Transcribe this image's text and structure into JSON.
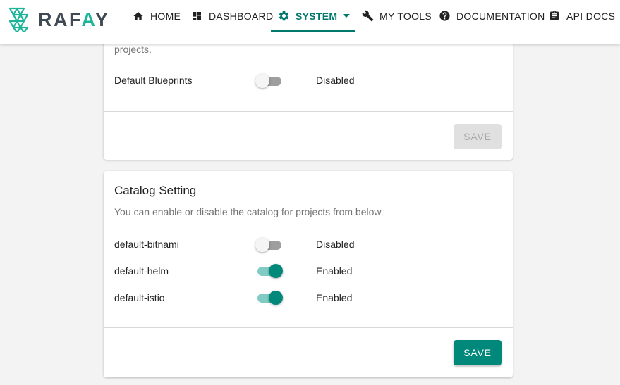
{
  "brand": {
    "name_left": "RAF",
    "name_accent": "A",
    "name_right": "Y",
    "accent_color": "#1db49a"
  },
  "nav": {
    "items": [
      {
        "label": "HOME",
        "icon": "home-icon"
      },
      {
        "label": "DASHBOARD",
        "icon": "dashboard-icon"
      },
      {
        "label": "SYSTEM",
        "icon": "gear-icon",
        "active": true,
        "has_dropdown": true
      },
      {
        "label": "MY TOOLS",
        "icon": "wrench-icon"
      },
      {
        "label": "DOCUMENTATION",
        "icon": "help-icon"
      },
      {
        "label": "API DOCS",
        "icon": "clipboard-icon"
      }
    ],
    "active_color": "#00796b"
  },
  "blueprint_card": {
    "partial_description": "projects.",
    "rows": [
      {
        "label": "Default Blueprints",
        "enabled": false,
        "status": "Disabled"
      }
    ],
    "save_label": "SAVE",
    "save_disabled": true
  },
  "catalog_card": {
    "title": "Catalog Setting",
    "description": "You can enable or disable the catalog for projects from below.",
    "rows": [
      {
        "label": "default-bitnami",
        "enabled": false,
        "status": "Disabled"
      },
      {
        "label": "default-helm",
        "enabled": true,
        "status": "Enabled"
      },
      {
        "label": "default-istio",
        "enabled": true,
        "status": "Enabled"
      }
    ],
    "save_label": "SAVE",
    "save_disabled": false
  },
  "colors": {
    "primary": "#00897b",
    "toggle_on_track": "#80cbc4",
    "toggle_off_track": "#9e9e9e"
  }
}
